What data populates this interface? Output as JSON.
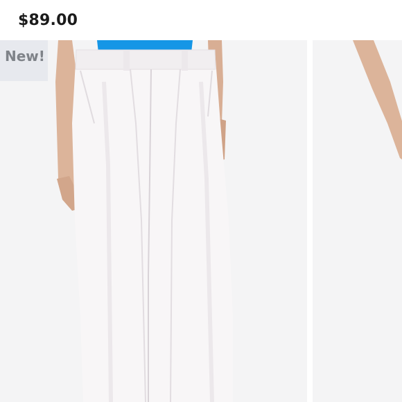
{
  "product": {
    "price": "$89.00",
    "badge": "New!",
    "colors": {
      "top": "#1596e6",
      "pants": "#f7f5f6",
      "background": "#f4f4f5",
      "badge_bg": "#e7e9ee"
    }
  },
  "carousel": {
    "images": [
      {
        "name": "product-photo-front",
        "subject": "white-wide-leg-pleated-trousers"
      },
      {
        "name": "product-photo-next",
        "subject": "model-arm-partial"
      }
    ]
  }
}
